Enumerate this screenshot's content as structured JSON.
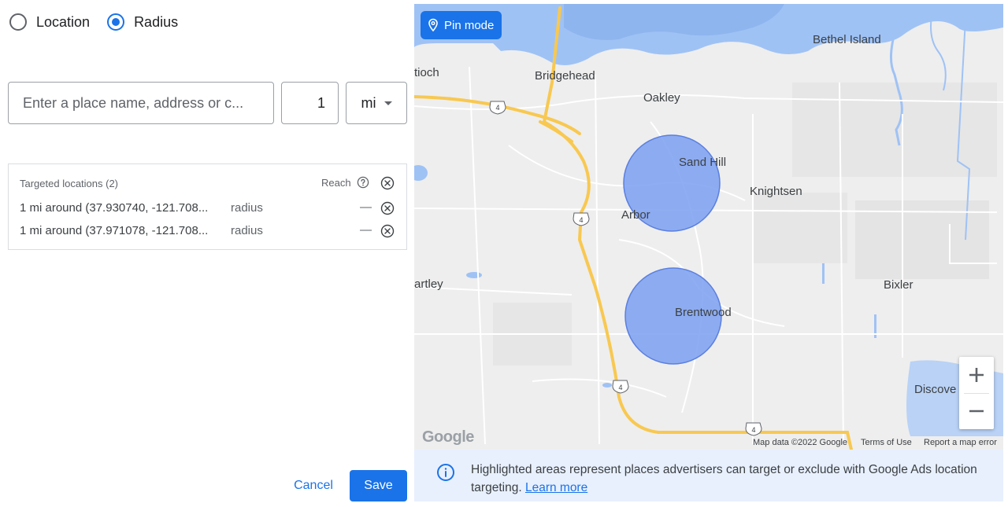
{
  "mode": {
    "location_label": "Location",
    "radius_label": "Radius",
    "selected": "Radius"
  },
  "search": {
    "placeholder": "Enter a place name, address or c...",
    "radius_value": "1",
    "unit": "mi"
  },
  "targeted": {
    "header": "Targeted locations (2)",
    "reach_label": "Reach",
    "rows": [
      {
        "text": "1 mi around (37.930740, -121.708...",
        "type": "radius",
        "reach": "—"
      },
      {
        "text": "1 mi around (37.971078, -121.708...",
        "type": "radius",
        "reach": "—"
      }
    ]
  },
  "actions": {
    "cancel": "Cancel",
    "save": "Save"
  },
  "map": {
    "pin_mode": "Pin mode",
    "places": {
      "tioch": "tioch",
      "bridgehead": "Bridgehead",
      "oakley": "Oakley",
      "bethel_island": "Bethel Island",
      "sand_hill": "Sand Hill",
      "knightsen": "Knightsen",
      "arbor": "Arbor",
      "artley": "artley",
      "bixler": "Bixler",
      "brentwood": "Brentwood",
      "discove": "Discove"
    },
    "highways": [
      "4",
      "4",
      "4",
      "4"
    ],
    "zoom_in": "+",
    "zoom_out": "−",
    "google": "Google",
    "map_data": "Map data ©2022 Google",
    "terms": "Terms of Use",
    "report": "Report a map error",
    "colors": {
      "land": "#eeeeee",
      "water": "#9fc2f5",
      "highway": "#f8c850",
      "radius_fill": "#7b9ff0"
    }
  },
  "info": {
    "text": "Highlighted areas represent places advertisers can target or exclude with Google Ads location targeting.",
    "link": "Learn more"
  },
  "colors": {
    "accent": "#1a73e8",
    "info_bg": "#e8f0fe"
  }
}
